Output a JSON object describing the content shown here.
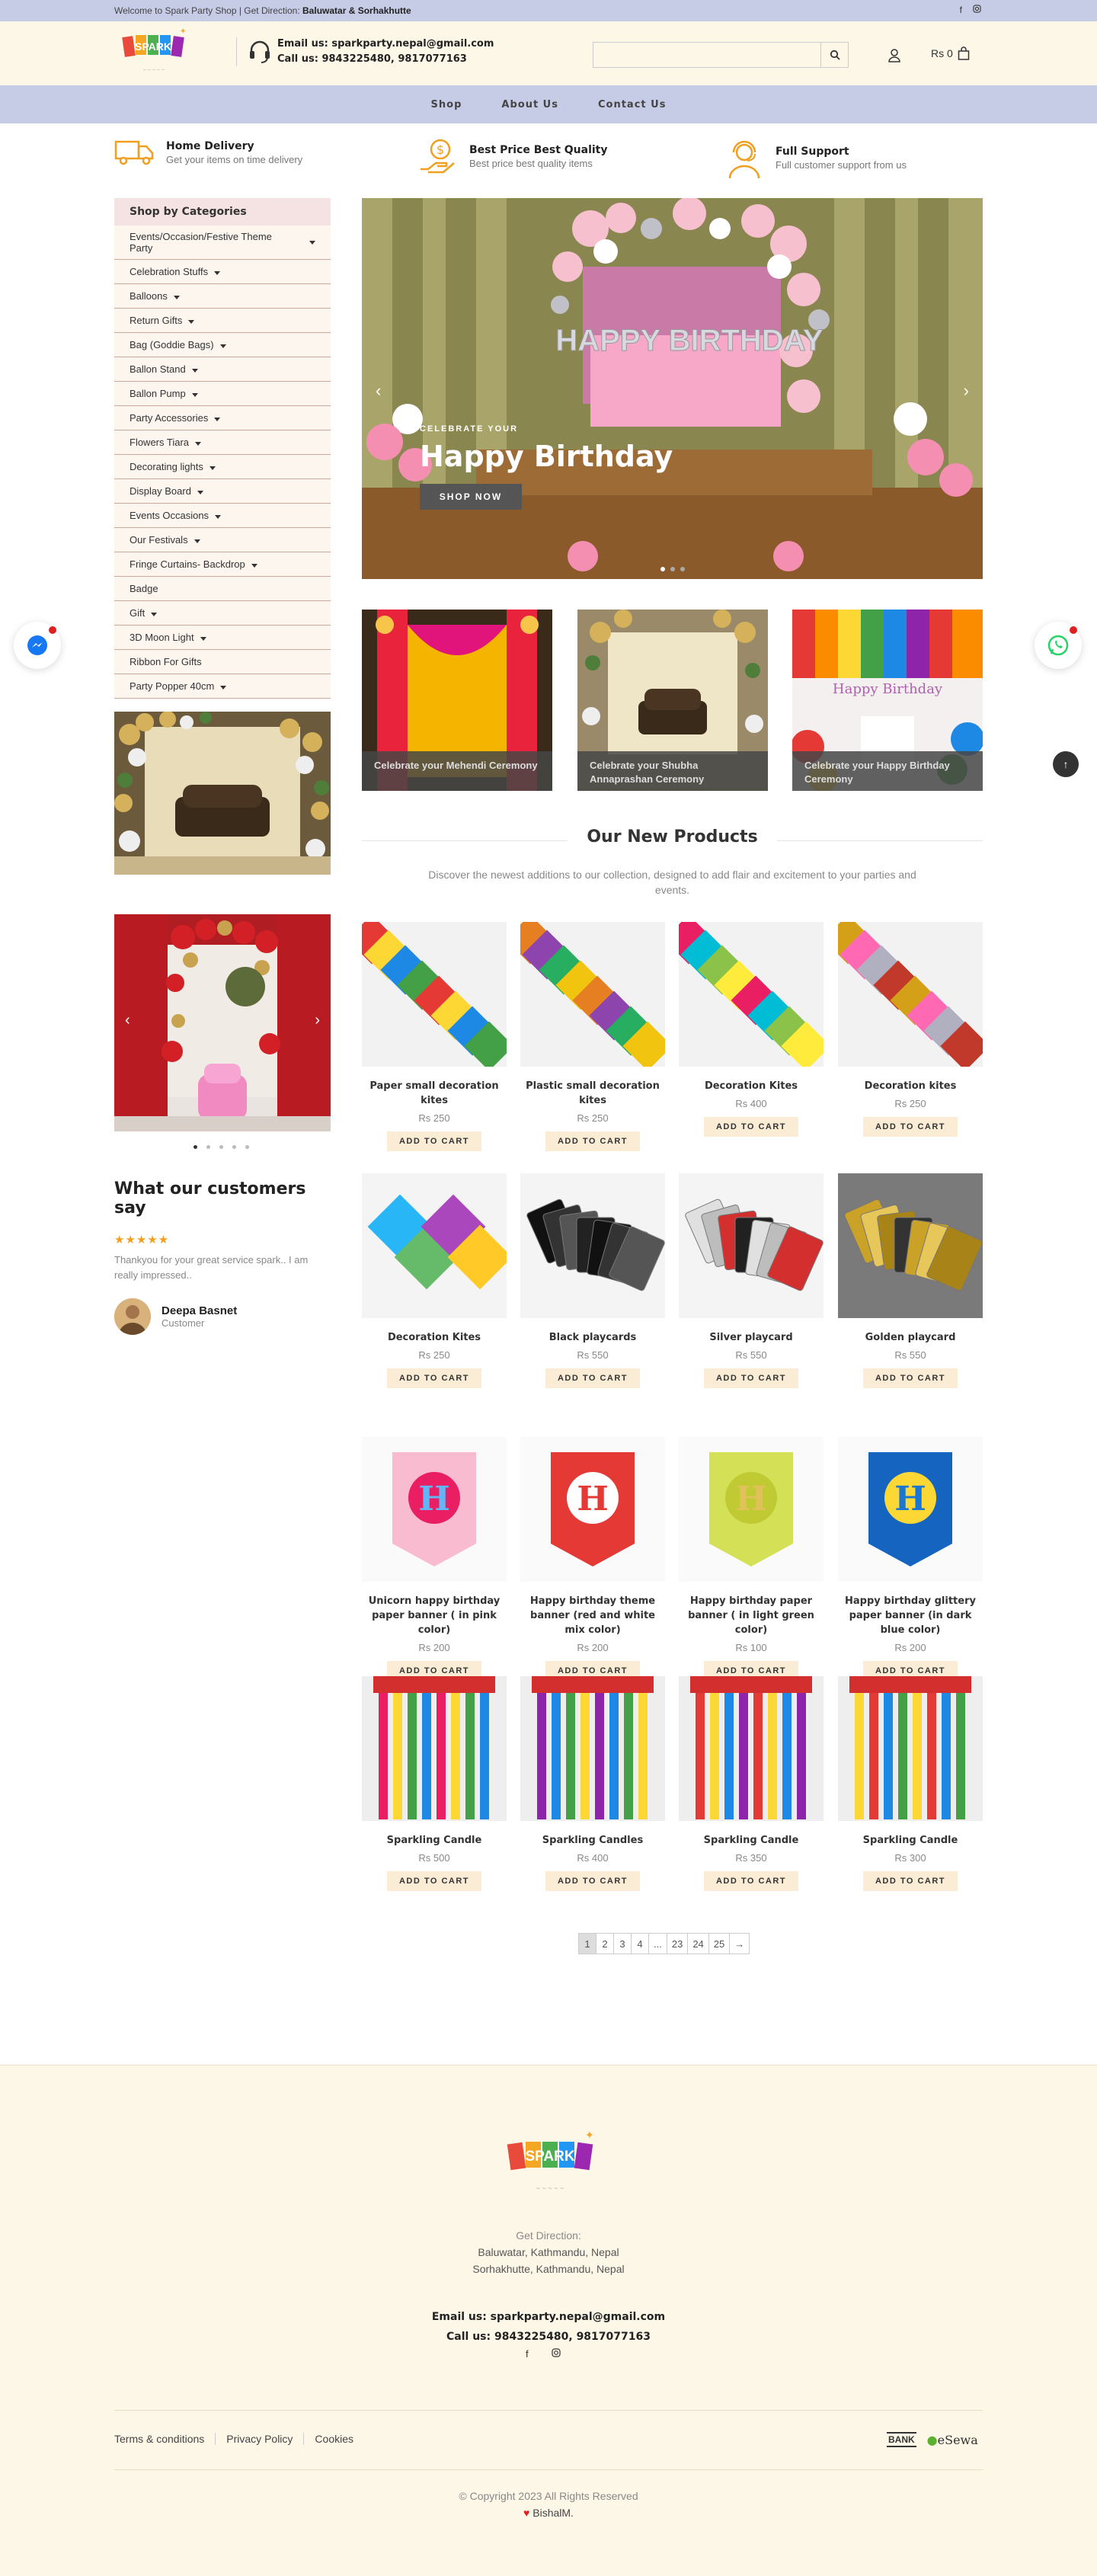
{
  "topbar": {
    "message": "Welcome to Spark Party Shop | Get Direction:",
    "direction": "Baluwatar & Sorhakhutte",
    "social": [
      "f",
      "instagram"
    ]
  },
  "header": {
    "brand": "SPARK",
    "email_line": "Email us: sparkparty.nepal@gmail.com",
    "phone_line": "Call us: 9843225480, 9817077163",
    "search_placeholder": "",
    "cart": "Rs 0"
  },
  "nav": {
    "items": [
      "Shop",
      "About Us",
      "Contact Us"
    ]
  },
  "features": [
    {
      "title": "Home Delivery",
      "subtitle": "Get your items on time delivery",
      "icon": "truck-icon"
    },
    {
      "title": "Best Price Best Quality",
      "subtitle": "Best price best quality items",
      "icon": "coin-hand-icon"
    },
    {
      "title": "Full Support",
      "subtitle": "Full customer support from us",
      "icon": "support-agent-icon"
    }
  ],
  "sidebar": {
    "heading": "Shop by Categories",
    "categories": [
      {
        "label": "Events/Occasion/Festive Theme Party",
        "caret": true
      },
      {
        "label": "Celebration Stuffs",
        "caret": true
      },
      {
        "label": "Balloons",
        "caret": true
      },
      {
        "label": "Return Gifts",
        "caret": true
      },
      {
        "label": "Bag (Goddie Bags)",
        "caret": true
      },
      {
        "label": "Ballon Stand",
        "caret": true
      },
      {
        "label": "Ballon Pump",
        "caret": true
      },
      {
        "label": "Party Accessories",
        "caret": true
      },
      {
        "label": "Flowers Tiara",
        "caret": true
      },
      {
        "label": "Decorating lights",
        "caret": true
      },
      {
        "label": "Display Board",
        "caret": true
      },
      {
        "label": "Events Occasions",
        "caret": true
      },
      {
        "label": "Our Festivals",
        "caret": true
      },
      {
        "label": "Fringe Curtains- Backdrop",
        "caret": true
      },
      {
        "label": "Badge",
        "caret": false
      },
      {
        "label": "Gift",
        "caret": true
      },
      {
        "label": "3D Moon Light",
        "caret": true
      },
      {
        "label": "Ribbon For Gifts",
        "caret": false
      },
      {
        "label": "Party Popper 40cm",
        "caret": true
      }
    ]
  },
  "hero": {
    "kicker": "CELEBRATE YOUR",
    "title": "Happy Birthday",
    "button": "SHOP NOW",
    "balloon_text": "HAPPY BIRTHDAY"
  },
  "banners": [
    {
      "label": "Celebrate your Mehendi Ceremony"
    },
    {
      "label": "Celebrate your Shubha Annaprashan Ceremony"
    },
    {
      "label": "Celebrate your Happy Birthday Ceremony"
    }
  ],
  "new_products": {
    "title": "Our New Products",
    "subtitle": "Discover the newest additions to our collection, designed to add flair and excitement to your parties and events.",
    "add_label": "ADD TO CART",
    "items": [
      {
        "name": "Paper small decoration kites",
        "price": "Rs 250"
      },
      {
        "name": "Plastic small decoration kites",
        "price": "Rs 250"
      },
      {
        "name": "Decoration Kites",
        "price": "Rs 400"
      },
      {
        "name": "Decoration kites",
        "price": "Rs 250"
      },
      {
        "name": "Decoration Kites",
        "price": "Rs 250"
      },
      {
        "name": "Black playcards",
        "price": "Rs 550"
      },
      {
        "name": "Silver playcard",
        "price": "Rs 550"
      },
      {
        "name": "Golden playcard",
        "price": "Rs 550"
      },
      {
        "name": "Unicorn happy birthday paper banner ( in pink color)",
        "price": "Rs 200"
      },
      {
        "name": "Happy birthday theme banner (red and white mix color)",
        "price": "Rs 200"
      },
      {
        "name": "Happy birthday paper banner ( in light green color)",
        "price": "Rs 100"
      },
      {
        "name": "Happy birthday glittery paper banner (in dark blue color)",
        "price": "Rs 200"
      },
      {
        "name": "Sparkling Candle",
        "price": "Rs 500"
      },
      {
        "name": "Sparkling Candles",
        "price": "Rs 400"
      },
      {
        "name": "Sparkling Candle",
        "price": "Rs 350"
      },
      {
        "name": "Sparkling Candle",
        "price": "Rs 300"
      }
    ]
  },
  "pagination": [
    "1",
    "2",
    "3",
    "4",
    "...",
    "23",
    "24",
    "25",
    "→"
  ],
  "testimonial": {
    "heading": "What our customers say",
    "stars": "★★★★★",
    "quote": "Thankyou for your great service spark.. I am really impressed..",
    "name": "Deepa Basnet",
    "role": "Customer"
  },
  "footer": {
    "get_direction": "Get Direction:",
    "addr1": "Baluwatar, Kathmandu, Nepal",
    "addr2": "Sorhakhutte, Kathmandu, Nepal",
    "email": "Email us: sparkparty.nepal@gmail.com",
    "phone": "Call us: 9843225480, 9817077163",
    "links": [
      "Terms & conditions",
      "Privacy Policy",
      "Cookies"
    ],
    "payment": [
      "BANK",
      "eSewa"
    ],
    "copyright": "© Copyright 2023 All Rights Reserved",
    "by": "BishalM."
  },
  "colors": {
    "topbar": "#c6cbe6",
    "header": "#fdf7e8",
    "accent": "#f0a020",
    "add_btn": "#fbecd6"
  }
}
